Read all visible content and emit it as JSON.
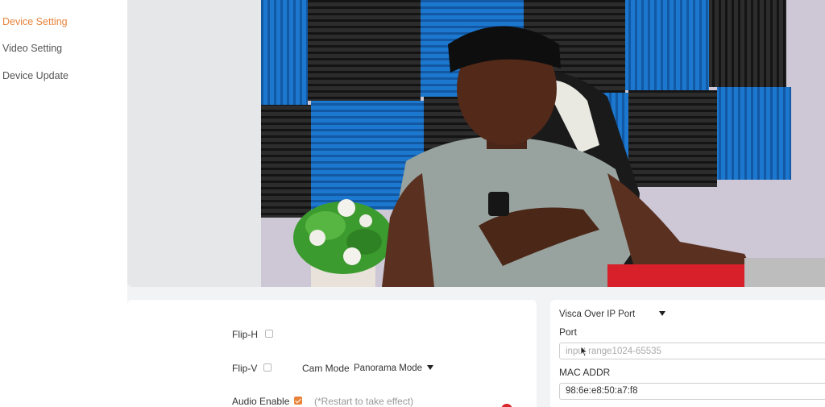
{
  "sidebar": {
    "items": [
      {
        "label": "Device Setting",
        "active": true
      },
      {
        "label": "Video Setting",
        "active": false
      },
      {
        "label": "Device Update",
        "active": false
      }
    ]
  },
  "preview": {
    "content": "Live camera feed showing a man in a grey t-shirt seated before blue and black acoustic foam panels with a potted plant"
  },
  "device_settings": {
    "flip_h": {
      "label": "Flip-H",
      "checked": false
    },
    "flip_v": {
      "label": "Flip-V",
      "checked": false
    },
    "cam_mode": {
      "label": "Cam Mode",
      "value": "Panorama Mode"
    },
    "audio_enable": {
      "label": "Audio Enable",
      "checked": true,
      "note": "(*Restart to take effect)"
    }
  },
  "network": {
    "protocol_select": "Visca Over IP Port",
    "port": {
      "label": "Port",
      "placeholder": "input range1024-65535",
      "value": ""
    },
    "mac": {
      "label": "MAC ADDR",
      "value": "98:6e:e8:50:a7:f8"
    }
  },
  "colors": {
    "accent": "#e8833a",
    "foam_blue": "#1a73c9",
    "foam_black": "#262626",
    "alert_red": "#d9262e"
  }
}
